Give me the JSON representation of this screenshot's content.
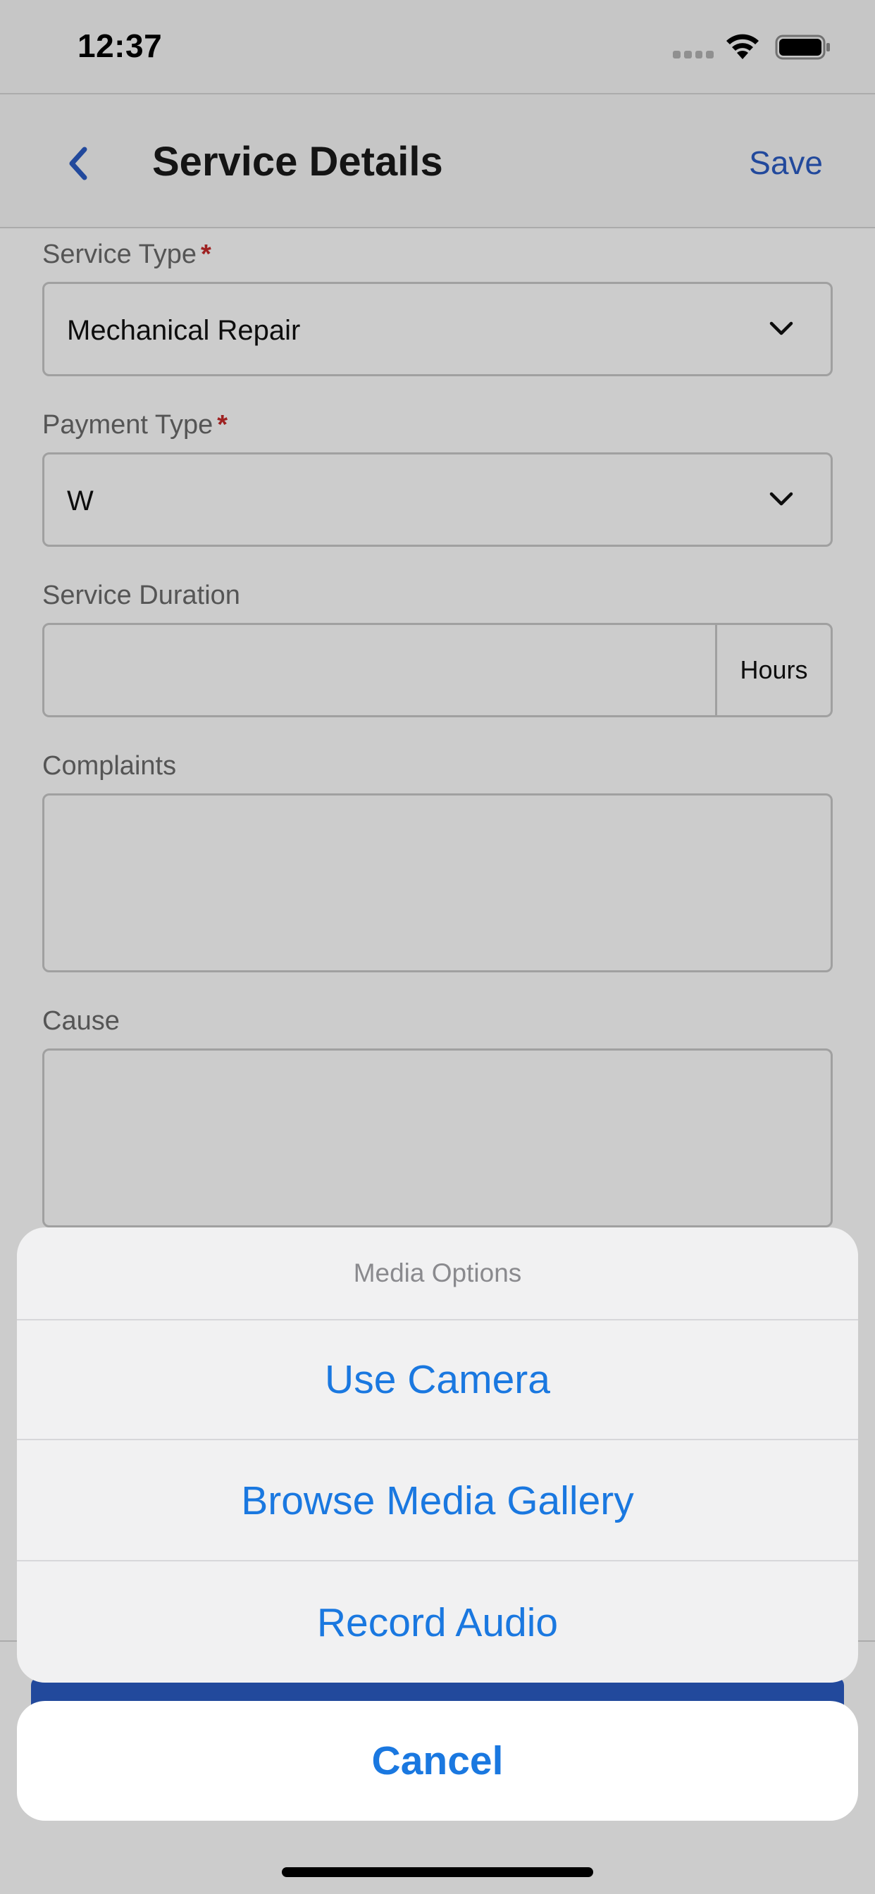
{
  "status_bar": {
    "time": "12:37"
  },
  "nav": {
    "title": "Service Details",
    "save_label": "Save"
  },
  "form": {
    "service_type": {
      "label": "Service Type",
      "required_mark": "*",
      "value": "Mechanical Repair"
    },
    "payment_type": {
      "label": "Payment Type",
      "required_mark": "*",
      "value": "W"
    },
    "service_duration": {
      "label": "Service Duration",
      "value": "",
      "unit": "Hours"
    },
    "complaints": {
      "label": "Complaints",
      "value": ""
    },
    "cause": {
      "label": "Cause",
      "value": ""
    }
  },
  "action_sheet": {
    "title": "Media Options",
    "options": [
      "Use Camera",
      "Browse Media Gallery",
      "Record Audio"
    ],
    "cancel_label": "Cancel"
  },
  "colors": {
    "accent": "#1a78e0",
    "nav_accent": "#2b5cc4",
    "required": "#c62a2a"
  }
}
